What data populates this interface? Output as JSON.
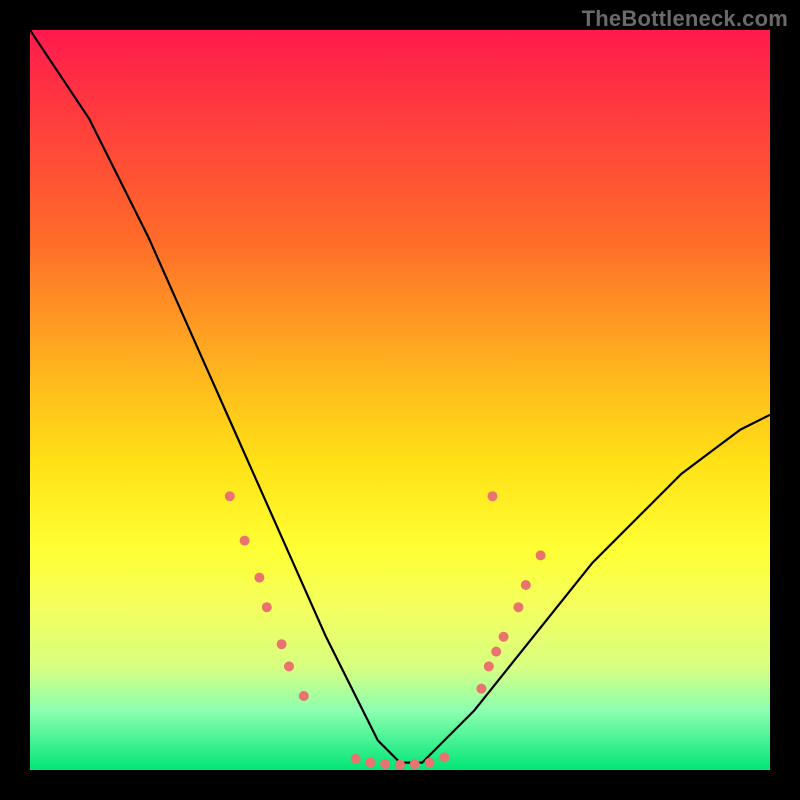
{
  "watermark": "TheBottleneck.com",
  "chart_data": {
    "type": "line",
    "title": "",
    "xlabel": "",
    "ylabel": "",
    "xlim": [
      0,
      100
    ],
    "ylim": [
      0,
      100
    ],
    "curve": {
      "name": "main-curve",
      "color": "#000000",
      "x": [
        0,
        4,
        8,
        12,
        16,
        20,
        24,
        28,
        32,
        36,
        40,
        44,
        47,
        50,
        53,
        56,
        60,
        64,
        68,
        72,
        76,
        80,
        84,
        88,
        92,
        96,
        100
      ],
      "y": [
        0,
        6,
        12,
        20,
        28,
        37,
        46,
        55,
        64,
        73,
        82,
        90,
        96,
        99,
        99,
        96,
        92,
        87,
        82,
        77,
        72,
        68,
        64,
        60,
        57,
        54,
        52
      ]
    },
    "markers": {
      "name": "highlight-points",
      "color": "#e9736e",
      "radius": 5,
      "points": [
        {
          "x": 27,
          "y": 63
        },
        {
          "x": 29,
          "y": 69
        },
        {
          "x": 31,
          "y": 74
        },
        {
          "x": 32,
          "y": 78
        },
        {
          "x": 34,
          "y": 83
        },
        {
          "x": 35,
          "y": 86
        },
        {
          "x": 37,
          "y": 90
        },
        {
          "x": 44,
          "y": 98.5
        },
        {
          "x": 46,
          "y": 99
        },
        {
          "x": 48,
          "y": 99.2
        },
        {
          "x": 50,
          "y": 99.3
        },
        {
          "x": 52,
          "y": 99.2
        },
        {
          "x": 54,
          "y": 99
        },
        {
          "x": 56,
          "y": 98.3
        },
        {
          "x": 61,
          "y": 89
        },
        {
          "x": 62,
          "y": 86
        },
        {
          "x": 63,
          "y": 84
        },
        {
          "x": 64,
          "y": 82
        },
        {
          "x": 66,
          "y": 78
        },
        {
          "x": 67,
          "y": 75
        },
        {
          "x": 69,
          "y": 71
        },
        {
          "x": 62.5,
          "y": 63
        }
      ]
    }
  }
}
